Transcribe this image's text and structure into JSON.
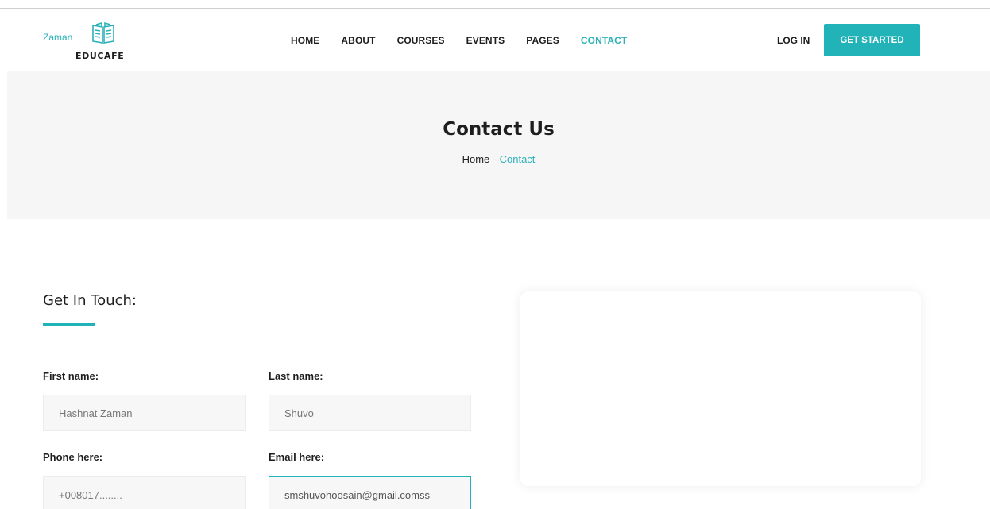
{
  "brand": {
    "top_text": "Zaman",
    "name": "EDUCAFE",
    "accent_color": "#21b3b8"
  },
  "nav": {
    "items": [
      "HOME",
      "ABOUT",
      "COURSES",
      "EVENTS",
      "PAGES",
      "CONTACT"
    ],
    "active": "CONTACT"
  },
  "header_actions": {
    "login_label": "LOG IN",
    "cta_label": "GET STARTED"
  },
  "hero": {
    "title": "Contact Us",
    "breadcrumb_home": "Home",
    "breadcrumb_sep": "-",
    "breadcrumb_current": "Contact"
  },
  "form": {
    "title": "Get In Touch:",
    "first_name_label": "First name:",
    "first_name_value": "Hashnat Zaman",
    "last_name_label": "Last name:",
    "last_name_value": "Shuvo",
    "phone_label": "Phone here:",
    "phone_value": "+008017........",
    "email_label": "Email here:",
    "email_value": "smshuvohoosain@gmail.comss"
  },
  "icons": {
    "logo": "open-book-icon"
  }
}
